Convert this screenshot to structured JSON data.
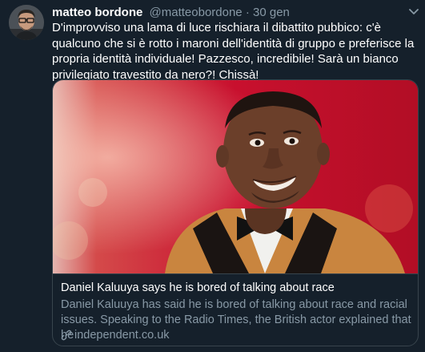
{
  "tweet": {
    "author_name": "matteo bordone",
    "author_handle": "@matteobordone",
    "separator": "·",
    "date": "30 gen",
    "text": "D'improvviso una lama di luce rischiara il dibattito pubbico: c'è qualcuno che si è rotto i maroni dell'identità di gruppo e preferisce la propria identità individuale! Pazzesco, incredibile! Sarà un bianco privilegiato travestito da nero?! Chissà!",
    "avatar_icon": "user-avatar",
    "menu_icon": "chevron-down-icon"
  },
  "card": {
    "title": "Daniel Kaluuya says he is bored of talking about race",
    "description": "Daniel Kaluuya has said he is bored of talking about race and racial issues. Speaking to the Radio Times, the British actor explained that he ...",
    "domain": "independent.co.uk",
    "link_icon": "link-icon"
  },
  "colors": {
    "background": "#15202b",
    "border": "#38444d",
    "muted_text": "#8899a6",
    "primary_text": "#ffffff",
    "photo_background": "#c8102e",
    "jacket": "#c9853f"
  }
}
